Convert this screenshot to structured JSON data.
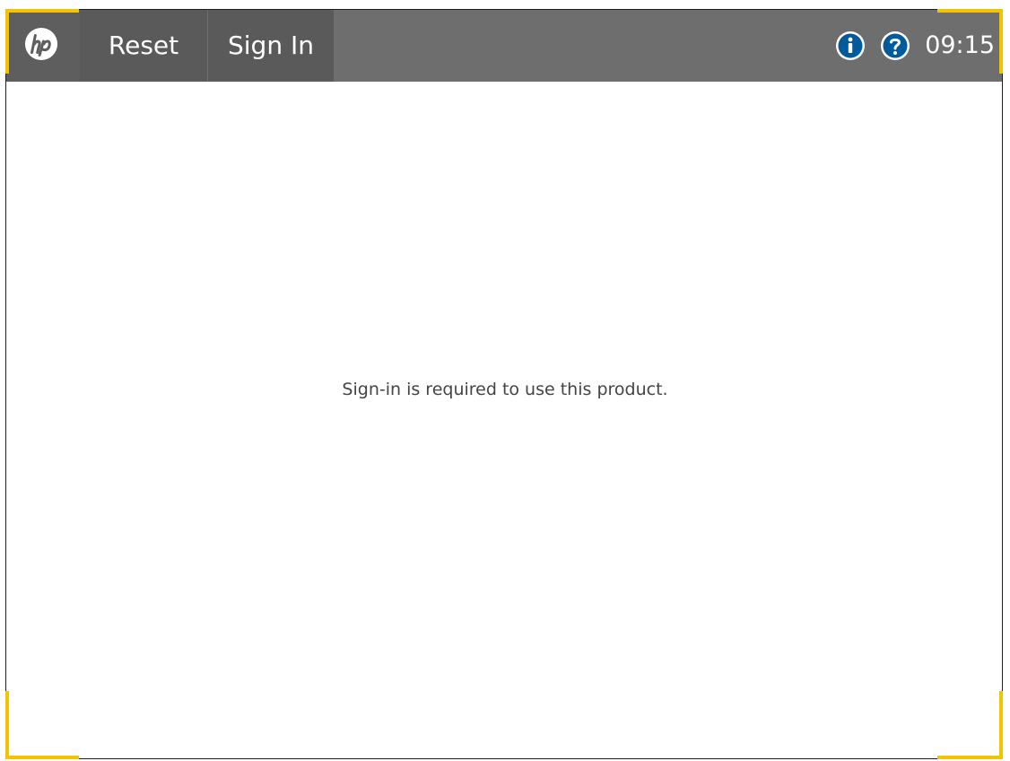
{
  "header": {
    "logo_icon": "hp-logo",
    "reset_label": "Reset",
    "sign_in_label": "Sign In",
    "info_icon": "info-icon",
    "help_icon": "help-icon",
    "time": "09:15"
  },
  "main": {
    "message": "Sign-in is required to use this product."
  },
  "colors": {
    "header_background": "#6e6e6e",
    "active_tab": "#5a5a5a",
    "icon_blue": "#005a9c",
    "corner_accent": "#f2c400"
  }
}
